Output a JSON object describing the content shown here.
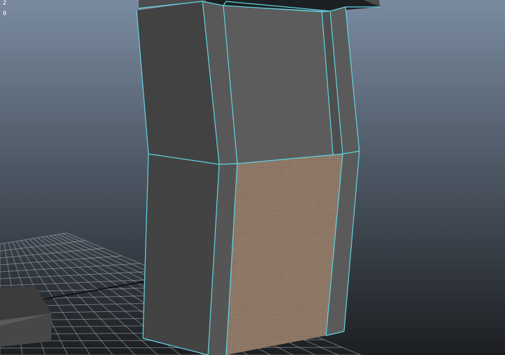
{
  "viewport": {
    "background_top_color": "#7a8ba0",
    "background_bottom_color": "#1c1e21",
    "wire_color": "#5fd6e4",
    "face_dark_color": "#424242",
    "face_mid_color": "#5a5a5a",
    "face_light_color": "#626262",
    "selected_face_color": "#8e7866",
    "grid_line_color": "#a9b0b6"
  },
  "hud": {
    "line1": "2",
    "line2": "0"
  }
}
